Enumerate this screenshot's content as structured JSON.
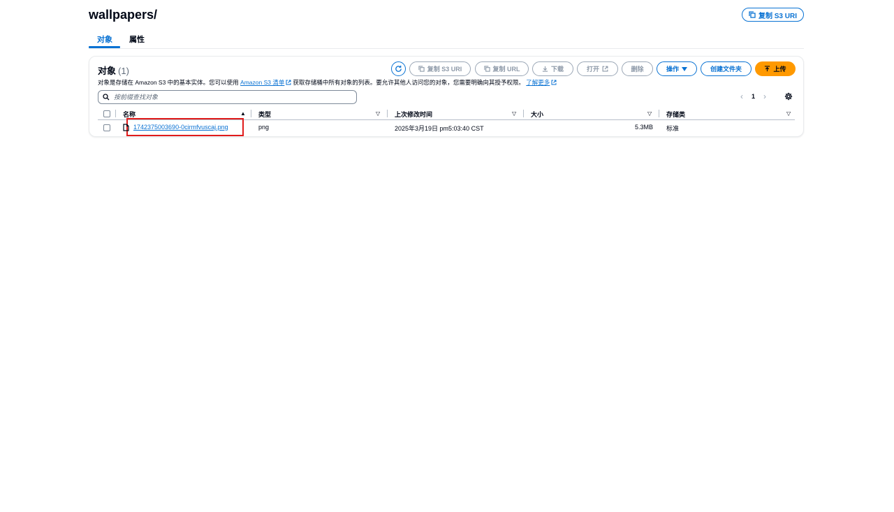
{
  "header": {
    "title": "wallpapers/",
    "copy_uri_label": "复制 S3 URI"
  },
  "tabs": [
    {
      "label": "对象",
      "active": true
    },
    {
      "label": "属性",
      "active": false
    }
  ],
  "objects_panel": {
    "title": "对象",
    "count": "(1)",
    "description_before_link": "对象是存储在 Amazon S3 中的基本实体。您可以使用",
    "inventory_link": "Amazon S3 清单",
    "description_middle": "获取存储桶中所有对象的列表。要允许其他人访问您的对象，您需要明确向其授予权限。",
    "learn_more_link": "了解更多",
    "toolbar": {
      "copy_s3_uri": "复制 S3 URI",
      "copy_url": "复制 URL",
      "download": "下载",
      "open": "打开",
      "delete": "删除",
      "actions": "操作",
      "create_folder": "创建文件夹",
      "upload": "上传"
    },
    "search_placeholder": "按前缀查找对象",
    "pagination": {
      "current_page": "1"
    },
    "columns": [
      "名称",
      "类型",
      "上次修改时间",
      "大小",
      "存储类"
    ],
    "rows": [
      {
        "name": "1742375003690-0cirmfvuscaj.png",
        "type": "png",
        "last_modified": "2025年3月19日 pm5:03:40 CST",
        "size": "5.3MB",
        "storage_class": "标准"
      }
    ]
  },
  "colors": {
    "link_blue": "#0972d3",
    "primary_orange": "#ff9900",
    "disabled_gray": "#8d99a8",
    "highlight_red": "#e01b1b"
  }
}
